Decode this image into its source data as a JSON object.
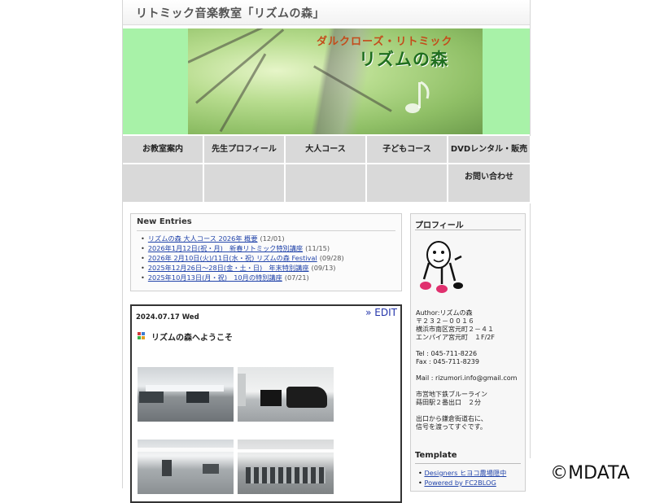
{
  "site_title": "リトミック音楽教室「リズムの森」",
  "banner": {
    "subtitle": "ダルクローズ・リトミック",
    "title": "リズムの森"
  },
  "nav": {
    "items": [
      "お教室案内",
      "先生プロフィール",
      "大人コース",
      "子どもコース",
      "DVDレンタル・販売"
    ],
    "row2": [
      "",
      "",
      "",
      "",
      "お問い合わせ"
    ]
  },
  "new_entries": {
    "heading": "New Entries",
    "items": [
      {
        "title": "リズムの森 大人コース 2026年 概要",
        "date": "(12/01)"
      },
      {
        "title": "2026年1月12日(祝・月)　新春リトミック特別講座",
        "date": "(11/15)"
      },
      {
        "title": "2026年 2月10日(火)/11日(水・祝) リズムの森 Festival",
        "date": "(09/28)"
      },
      {
        "title": "2025年12月26日〜28日(金・土・日)　年末特別講座",
        "date": "(09/13)"
      },
      {
        "title": "2025年10月13日(月・祝)　10月の特別講座",
        "date": "(07/21)"
      }
    ]
  },
  "post": {
    "date": "2024.07.17 Wed",
    "edit_label": "» EDIT",
    "title": "リズムの森へようこそ",
    "photos": [
      "studio-photo-1",
      "studio-photo-2",
      "studio-photo-3",
      "studio-photo-4"
    ]
  },
  "sidebar": {
    "profile_heading": "プロフィール",
    "profile_lines": [
      "Author:リズムの森",
      "〒２３２－００１６",
      "横浜市南区宮元町２－４１",
      "エンパイア宮元町　１F/2F",
      "",
      "Tel : 045-711-8226",
      "Fax : 045-711-8239",
      "",
      "Mail : rizumori.info@gmail.com",
      "",
      "市営地下鉄ブルーライン",
      "蒔田駅２番出口　２分",
      "",
      "出口から鎌倉街道右に、",
      "信号を渡ってすぐです。"
    ],
    "template_heading": "Template",
    "template_links": [
      "Designers ヒヨコ農場隠中",
      "Powered by FC2BLOG"
    ]
  },
  "watermark": "©MDATA",
  "colors": {
    "banner_bg": "#a8f2a8",
    "nav_bg": "#d9d9d9",
    "link": "#2244aa",
    "edit_link": "#2233aa",
    "banner_subtitle": "#c44b1a",
    "banner_title": "#1f6e1f"
  },
  "icons": {
    "post_title": "colored-squares-icon",
    "profile_avatar": "music-note-character-icon"
  }
}
